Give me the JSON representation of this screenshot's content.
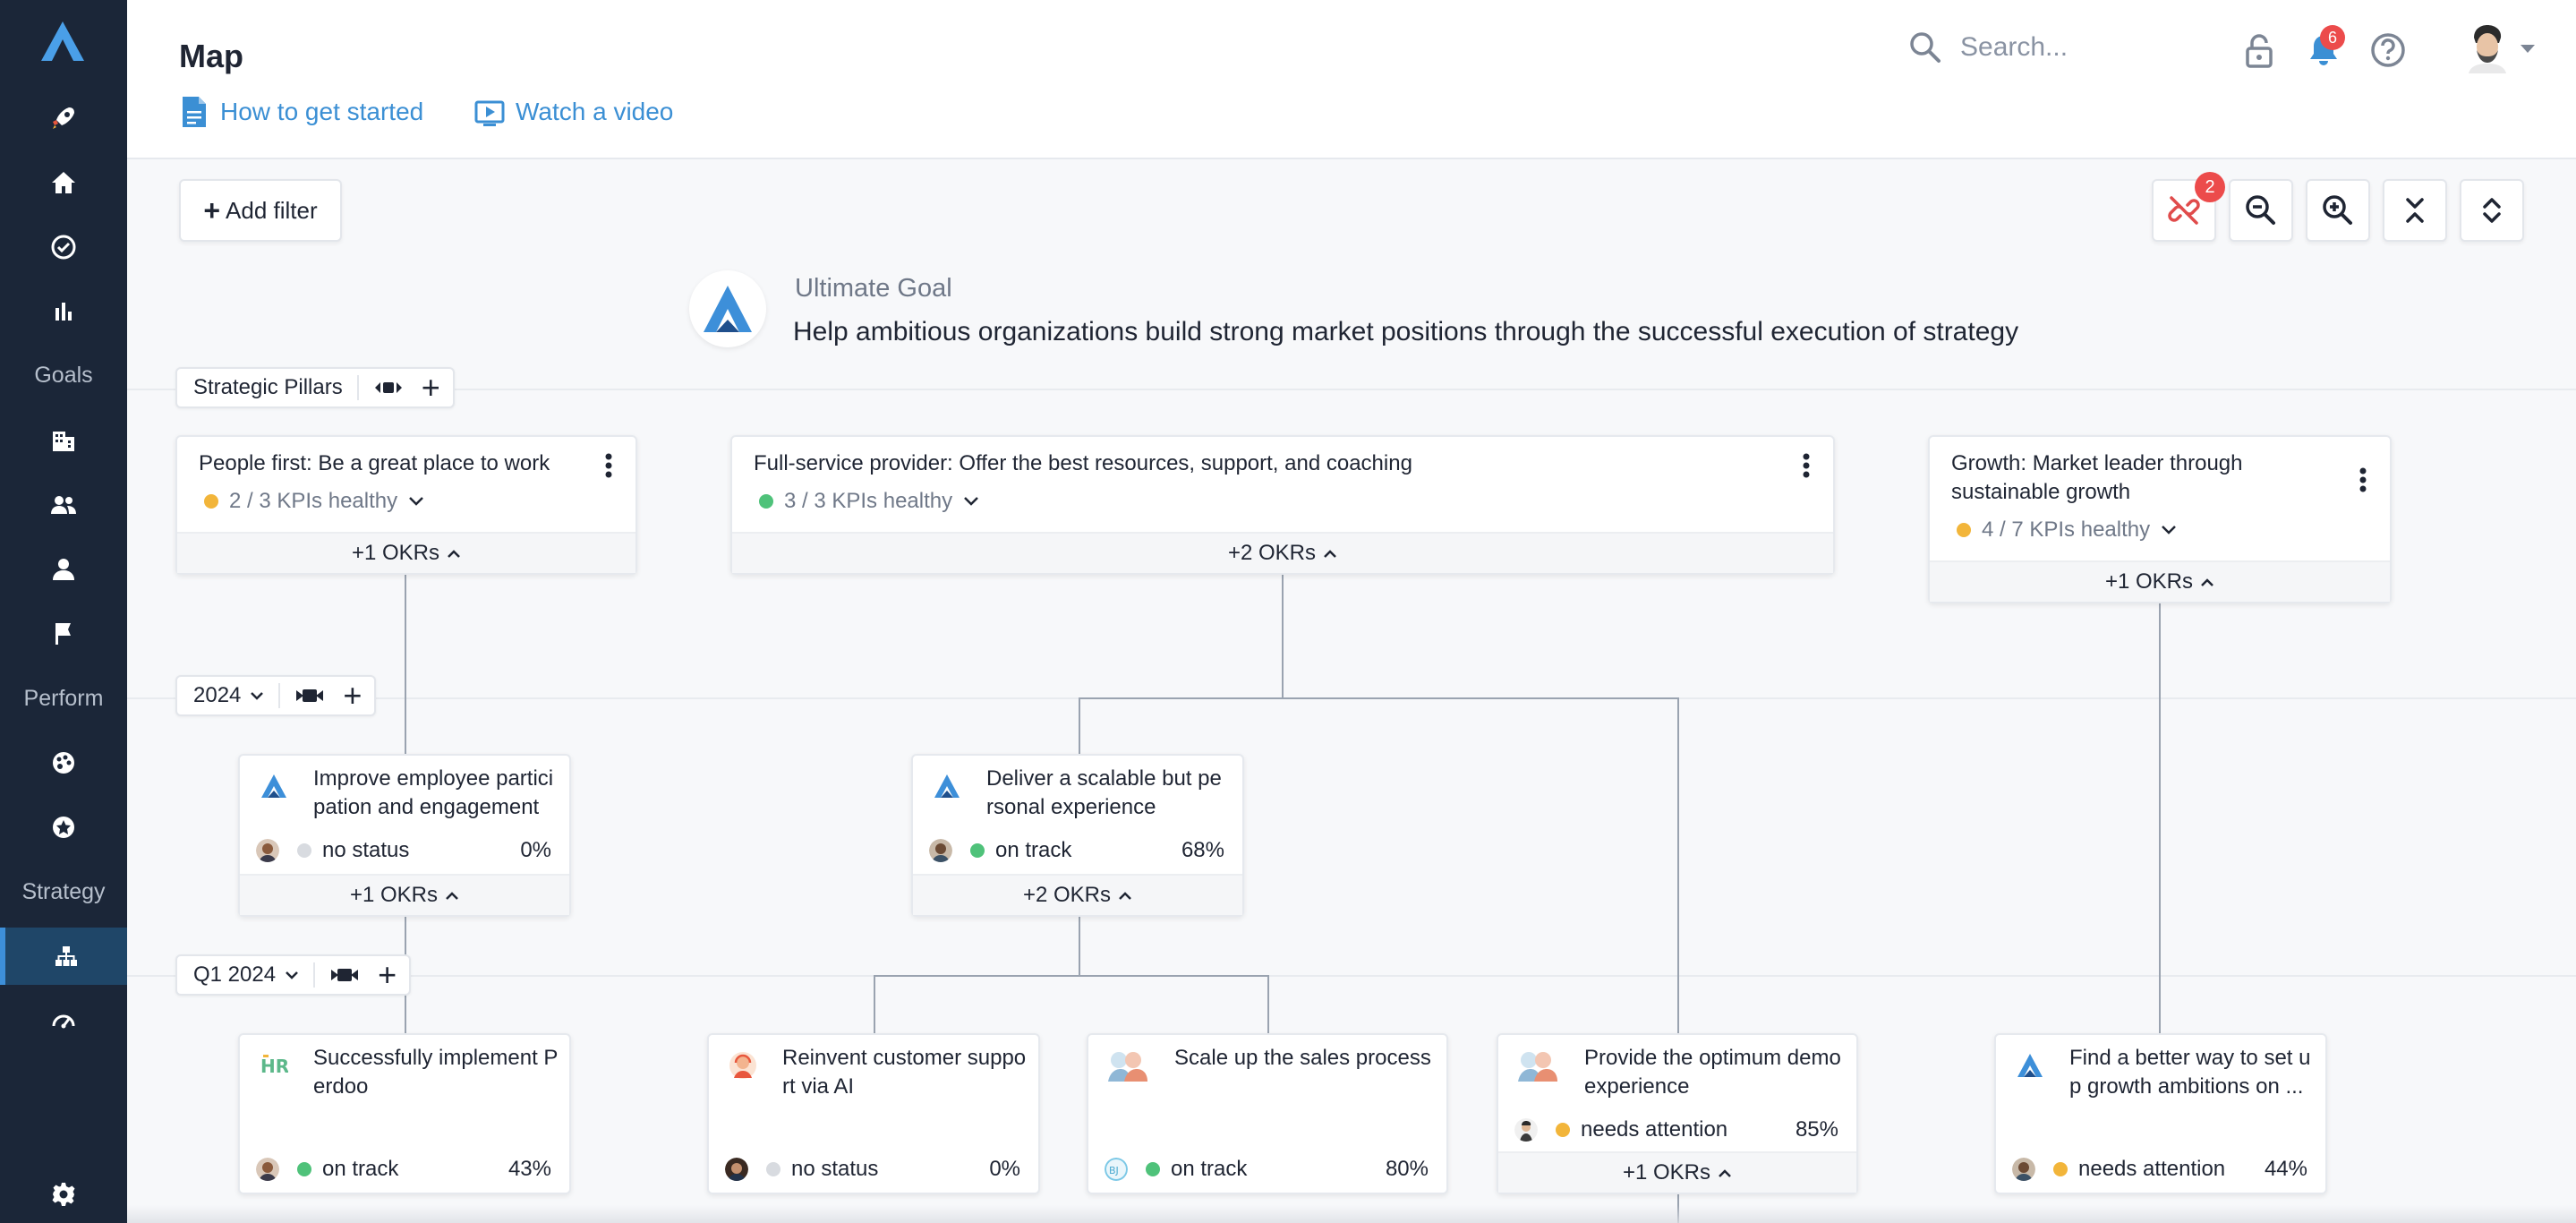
{
  "sidebar": {
    "sections": [
      "Goals",
      "Perform",
      "Strategy"
    ]
  },
  "header": {
    "title": "Map",
    "links": [
      {
        "label": "How to get started",
        "icon": "document-icon"
      },
      {
        "label": "Watch a video",
        "icon": "video-icon"
      }
    ],
    "search_placeholder": "Search...",
    "notification_count": "6"
  },
  "toolbar": {
    "add_filter": "Add filter",
    "unlinked_count": "2"
  },
  "ultimate_goal": {
    "label": "Ultimate Goal",
    "text": "Help ambitious organizations build strong market positions through the successful execution of strategy"
  },
  "levels": {
    "pillars": "Strategic Pillars",
    "year": "2024",
    "quarter": "Q1 2024"
  },
  "pillars": [
    {
      "title": "People first: Be a great place to work",
      "kpi": "2 / 3 KPIs healthy",
      "kpi_color": "#f2b53a",
      "okrs": "+1 OKRs"
    },
    {
      "title": "Full-service provider: Offer the best resources, support, and coaching",
      "kpi": "3 / 3 KPIs healthy",
      "kpi_color": "#4fc27a",
      "okrs": "+2 OKRs"
    },
    {
      "title_1": "Growth: Market leader through",
      "title_2": "sustainable growth",
      "kpi": "4 / 7 KPIs healthy",
      "kpi_color": "#f2b53a",
      "okrs": "+1 OKRs"
    }
  ],
  "year_objectives": [
    {
      "title_1": "Improve employee partici",
      "title_2": "pation and engagement",
      "status": "no status",
      "status_color": "#d8dbe0",
      "progress": "0%",
      "okrs": "+1 OKRs"
    },
    {
      "title_1": "Deliver a scalable but pe",
      "title_2": "rsonal experience",
      "status": "on track",
      "status_color": "#4fc27a",
      "progress": "68%",
      "okrs": "+2 OKRs"
    }
  ],
  "quarter_objectives": [
    {
      "title_1": "Successfully implement P",
      "title_2": "erdoo",
      "status": "on track",
      "status_color": "#4fc27a",
      "progress": "43%"
    },
    {
      "title_1": "Reinvent customer suppo",
      "title_2": "rt via AI",
      "status": "no status",
      "status_color": "#d8dbe0",
      "progress": "0%"
    },
    {
      "title_1": "Scale up the sales process",
      "title_2": "",
      "status": "on track",
      "status_color": "#4fc27a",
      "progress": "80%"
    },
    {
      "title_1": "Provide the optimum demo",
      "title_2": "experience",
      "status": "needs attention",
      "status_color": "#f2b53a",
      "progress": "85%",
      "okrs": "+1 OKRs"
    },
    {
      "title_1": "Find a better way to set u",
      "title_2": "p growth ambitions on ...",
      "status": "needs attention",
      "status_color": "#f2b53a",
      "progress": "44%"
    }
  ]
}
